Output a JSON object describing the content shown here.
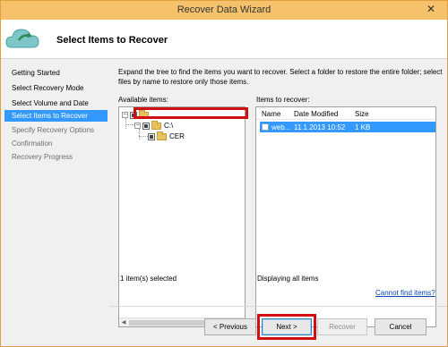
{
  "window": {
    "title": "Recover Data Wizard",
    "close_glyph": "✕"
  },
  "header": {
    "title": "Select Items to Recover",
    "icon": "cloud-recover-icon"
  },
  "nav": {
    "items": [
      {
        "label": "Getting Started",
        "state": "done"
      },
      {
        "label": "Select Recovery Mode",
        "state": "done"
      },
      {
        "label": "Select Volume and Date",
        "state": "done"
      },
      {
        "label": "Select Items to Recover",
        "state": "active"
      },
      {
        "label": "Specify Recovery Options",
        "state": "pending"
      },
      {
        "label": "Confirmation",
        "state": "pending"
      },
      {
        "label": "Recovery Progress",
        "state": "pending"
      }
    ]
  },
  "content": {
    "instructions": "Expand the tree to find the items you want to recover. Select a folder to restore the entire folder; select files by name to restore only those items.",
    "available_label": "Available items:",
    "recover_label": "Items to recover:",
    "tree": {
      "root": {
        "label": "",
        "expander": "−"
      },
      "drive": {
        "label": "C:\\",
        "expander": "−"
      },
      "folder": {
        "label": "CER"
      }
    },
    "list": {
      "columns": [
        "Name",
        "Date Modified",
        "Size"
      ],
      "rows": [
        {
          "name": "web...",
          "date": "11.1.2013 10:52",
          "size": "1 KB"
        }
      ]
    },
    "selected_status": "1 item(s) selected",
    "display_status": "Displaying all items",
    "help_link": "Cannot find items?"
  },
  "buttons": {
    "previous": "< Previous",
    "next": "Next >",
    "recover": "Recover",
    "cancel": "Cancel"
  },
  "colors": {
    "titlebar": "#f5c26b",
    "selection": "#3399ff",
    "highlight": "#d01010"
  }
}
